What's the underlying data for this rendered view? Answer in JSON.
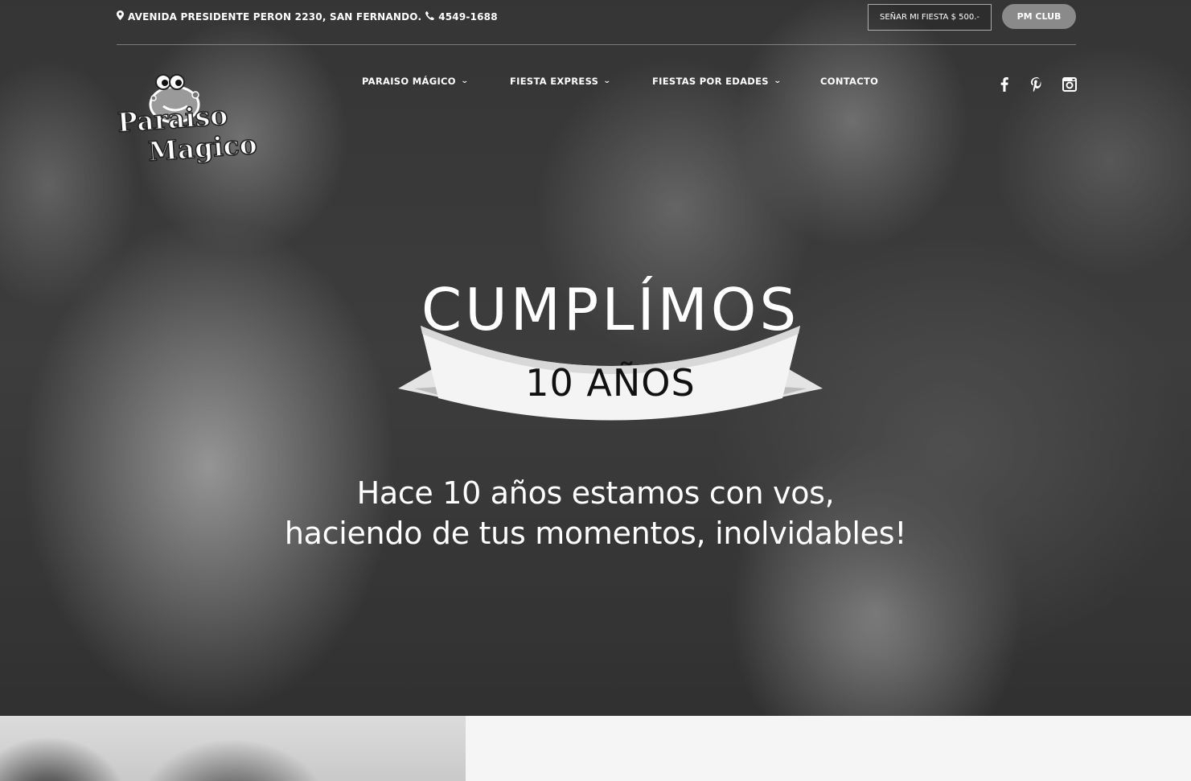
{
  "topbar": {
    "address": "AVENIDA PRESIDENTE PERON 2230, SAN FERNANDO.",
    "phone": "4549-1688",
    "senar_button": "SEÑAR MI FIESTA $ 500.-",
    "club_button": "PM CLUB"
  },
  "logo": {
    "line1": "Paraiso",
    "line2": "Magico"
  },
  "nav": {
    "items": [
      {
        "label": "PARAISO MÁGICO",
        "has_dropdown": true
      },
      {
        "label": "FIESTA EXPRESS",
        "has_dropdown": true
      },
      {
        "label": "FIESTAS POR EDADES",
        "has_dropdown": true
      },
      {
        "label": "CONTACTO",
        "has_dropdown": false
      }
    ],
    "social": [
      "facebook-icon",
      "pinterest-icon",
      "instagram-icon"
    ]
  },
  "hero": {
    "headline": "CUMPLÍMOS",
    "ribbon_text": "10 AÑOS",
    "tagline_line1": "Hace 10 años estamos con vos,",
    "tagline_line2": "haciendo de tus momentos, inolvidables!"
  },
  "colors": {
    "club_button_bg": "#8a8a8a",
    "text_light": "#ffffff",
    "ribbon_text": "#111111",
    "page_bg": "#f5f5f5"
  }
}
